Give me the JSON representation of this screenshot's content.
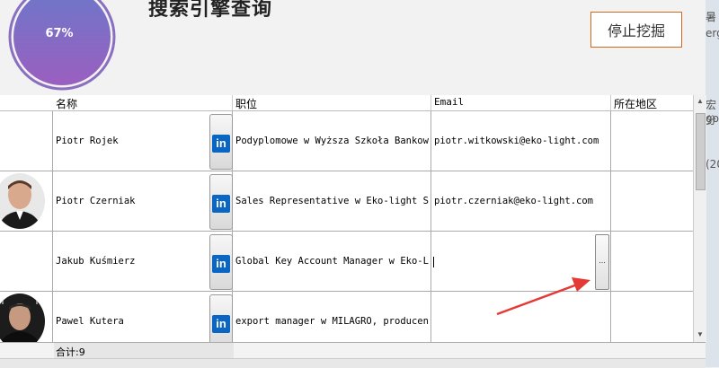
{
  "header": {
    "progress_value": 67,
    "progress_label": "67%",
    "title": "搜索引擎查询",
    "stop_button_label": "停止挖掘"
  },
  "table": {
    "columns": [
      "名称",
      "职位",
      "Email",
      "所在地区"
    ],
    "rows": [
      {
        "name": "Piotr Rojek",
        "position": "Podyplomowe w Wyższa Szkoła Bankowa w",
        "email": "piotr.witkowski@eko-light.com",
        "region": "",
        "has_avatar": false
      },
      {
        "name": "Piotr Czerniak",
        "position": "Sales Representative w Eko-light Sp.",
        "email": "piotr.czerniak@eko-light.com",
        "region": "",
        "has_avatar": true
      },
      {
        "name": "Jakub Kuśmierz",
        "position": "Global Key Account Manager w Eko-Lig",
        "email": "",
        "region": "",
        "has_avatar": false
      },
      {
        "name": "Pawel Kutera",
        "position": "export manager w MILAGRO, producent",
        "email": "",
        "region": "",
        "has_avatar": true
      }
    ],
    "linkedin_icon_text": "in",
    "ellipsis_label": "..."
  },
  "footer": {
    "total_label": "合计:9"
  },
  "side_strip": [
    "暑",
    "erg",
    "宏分",
    "go",
    "(20"
  ],
  "colors": {
    "accent_purple": "#8a6fc0",
    "button_border": "#d2691e",
    "linkedin_blue": "#0a66c2",
    "arrow_red": "#e53935"
  },
  "icons": [
    "linkedin-icon",
    "ellipsis-icon",
    "arrow-up-icon",
    "arrow-down-icon"
  ]
}
